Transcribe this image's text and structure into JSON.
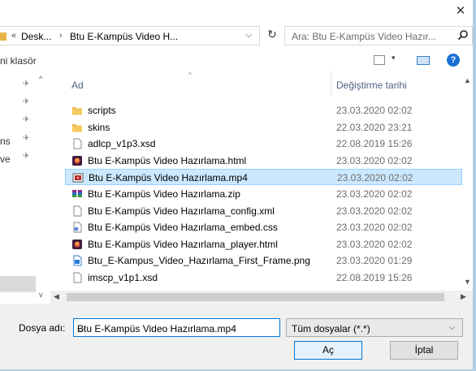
{
  "titlebar": {
    "close_glyph": "✕"
  },
  "address": {
    "chevron": "«",
    "crumbs": [
      "Desk...",
      "Btu E-Kampüs Video H..."
    ],
    "separator": "›",
    "dropdown_glyph": "⌵",
    "refresh_glyph": "↻"
  },
  "search": {
    "placeholder": "Ara: Btu E-Kampüs Video Hazır..."
  },
  "toolbar": {
    "new_folder_label": "ni klasör",
    "view_dropdown": "▾",
    "help_label": "?"
  },
  "nav": {
    "items": [
      {
        "label": "",
        "pinned": true
      },
      {
        "label": "",
        "pinned": true
      },
      {
        "label": "",
        "pinned": true
      },
      {
        "label": "ns",
        "pinned": true
      },
      {
        "label": "ve",
        "pinned": true
      }
    ],
    "pin_glyph": "✈"
  },
  "columns": {
    "name": "Ad",
    "date": "Değiştirme tarihi",
    "sort_glyph": "^"
  },
  "files": [
    {
      "name": "scripts",
      "date": "23.03.2020 02:02",
      "icon": "folder-icon",
      "selected": false
    },
    {
      "name": "skins",
      "date": "22.03.2020 23:21",
      "icon": "folder-icon",
      "selected": false
    },
    {
      "name": "adlcp_v1p3.xsd",
      "date": "22.08.2019 15:26",
      "icon": "document-icon",
      "selected": false
    },
    {
      "name": "Btu E-Kampüs Video Hazırlama.html",
      "date": "23.03.2020 02:02",
      "icon": "html-file-icon",
      "selected": false
    },
    {
      "name": "Btu E-Kampüs Video Hazırlama.mp4",
      "date": "23.03.2020 02:02",
      "icon": "video-file-icon",
      "selected": true
    },
    {
      "name": "Btu E-Kampüs Video Hazırlama.zip",
      "date": "23.03.2020 02:02",
      "icon": "archive-icon",
      "selected": false
    },
    {
      "name": "Btu E-Kampüs Video Hazırlama_config.xml",
      "date": "23.03.2020 02:02",
      "icon": "document-icon",
      "selected": false
    },
    {
      "name": "Btu E-Kampüs Video Hazırlama_embed.css",
      "date": "23.03.2020 02:02",
      "icon": "css-file-icon",
      "selected": false
    },
    {
      "name": "Btu E-Kampüs Video Hazırlama_player.html",
      "date": "23.03.2020 02:02",
      "icon": "html-file-icon",
      "selected": false
    },
    {
      "name": "Btu_E-Kampus_Video_Hazırlama_First_Frame.png",
      "date": "23.03.2020 01:29",
      "icon": "image-file-icon",
      "selected": false
    },
    {
      "name": "imscp_v1p1.xsd",
      "date": "22.08.2019 15:26",
      "icon": "document-icon",
      "selected": false
    }
  ],
  "scroll": {
    "up": "▲",
    "down": "▼",
    "left": "◀",
    "right": "▶",
    "nav_up": "^",
    "nav_down": "v"
  },
  "footer": {
    "filename_label": "Dosya adı:",
    "filename_value": "Btu E-Kampüs Video Hazırlama.mp4",
    "filename_dropdown": "⌵",
    "filter_value": "Tüm dosyalar (*.*)",
    "filter_dropdown": "⌵",
    "ok_label": "Aç",
    "cancel_label": "İptal"
  },
  "colors": {
    "selection": "#cce8ff",
    "accent": "#0078d7",
    "folder": "#e8b545"
  }
}
